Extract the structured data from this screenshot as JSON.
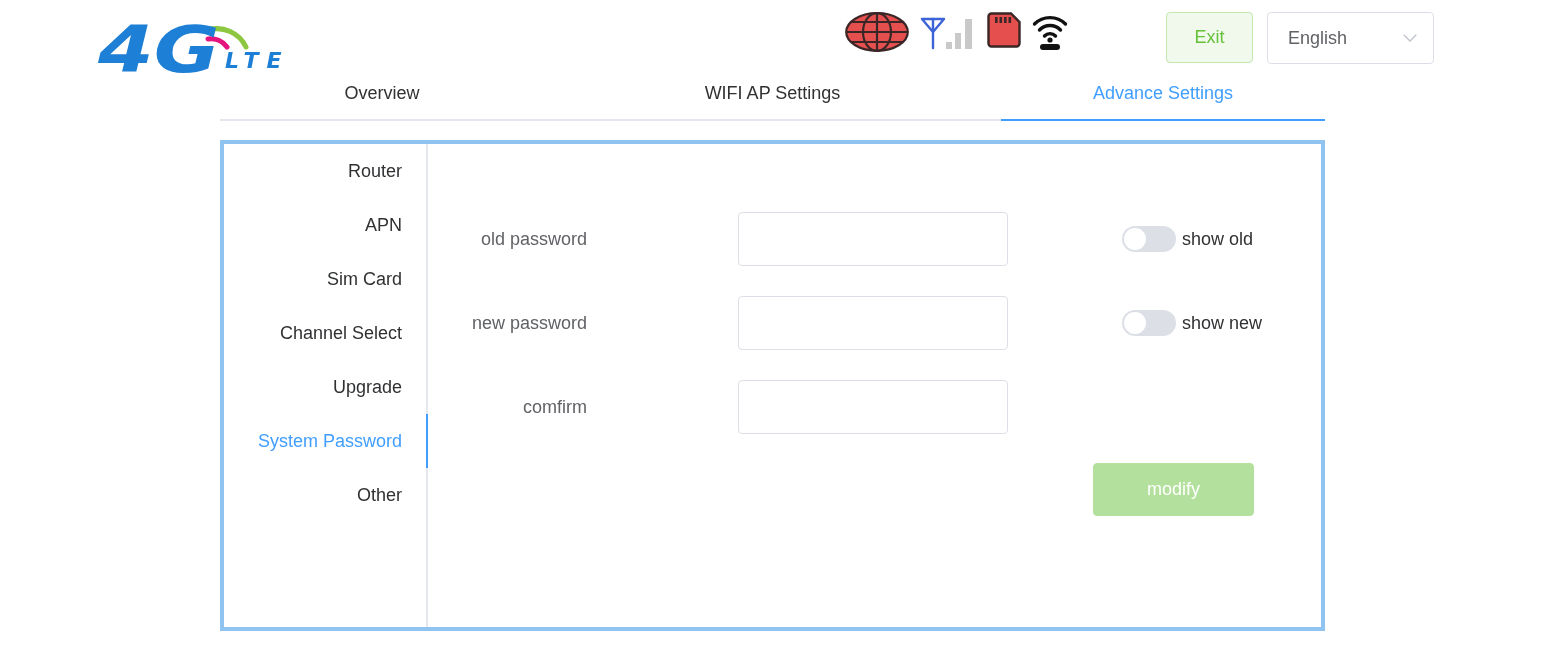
{
  "header": {
    "logo": {
      "text": "4G",
      "subtext": "LTE"
    },
    "exit_button": {
      "label": "Exit"
    },
    "language_select": {
      "value": "English"
    }
  },
  "tabs": [
    {
      "label": "Overview",
      "selected": false
    },
    {
      "label": "WIFI AP Settings",
      "selected": false
    },
    {
      "label": "Advance Settings",
      "selected": true
    }
  ],
  "sidebar": {
    "items": [
      {
        "label": "Router",
        "selected": false
      },
      {
        "label": "APN",
        "selected": false
      },
      {
        "label": "Sim Card",
        "selected": false
      },
      {
        "label": "Channel Select",
        "selected": false
      },
      {
        "label": "Upgrade",
        "selected": false
      },
      {
        "label": "System Password",
        "selected": true
      },
      {
        "label": "Other",
        "selected": false
      }
    ]
  },
  "form": {
    "fields": [
      {
        "label": "old password",
        "toggle": {
          "label": "show old",
          "on": false
        }
      },
      {
        "label": "new password",
        "toggle": {
          "label": "show new",
          "on": false
        }
      },
      {
        "label": "comfirm"
      }
    ],
    "submit": {
      "label": "modify",
      "disabled": true
    }
  }
}
